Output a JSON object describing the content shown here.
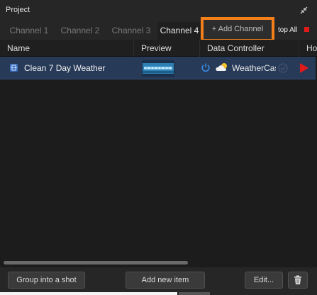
{
  "panel": {
    "title": "Project"
  },
  "tabs": [
    {
      "label": "Channel 1",
      "active": false
    },
    {
      "label": "Channel 2",
      "active": false
    },
    {
      "label": "Channel 3",
      "active": false
    },
    {
      "label": "Channel 4",
      "active": true
    }
  ],
  "toolbar": {
    "add_channel_label": "+ Add Channel",
    "stop_all_label": "top All"
  },
  "columns": {
    "name": "Name",
    "preview": "Preview",
    "data_controller": "Data Controller",
    "truncated": "Ho"
  },
  "rows": [
    {
      "name": "Clean 7 Day Weather",
      "data_controller": "WeatherCas",
      "selected": true
    }
  ],
  "buttons": {
    "group": "Group into a shot",
    "add_item": "Add new item",
    "edit": "Edit..."
  },
  "colors": {
    "highlight": "#f27f1a",
    "selection": "#273a58",
    "stop": "#e21a1a",
    "play": "#e21a1a",
    "power": "#3a8ee6"
  },
  "icons": [
    "collapse-icon",
    "stop-icon",
    "item-icon",
    "preview-thumbnail",
    "power-icon",
    "cloud-icon",
    "check-icon",
    "play-icon",
    "trash-icon"
  ]
}
